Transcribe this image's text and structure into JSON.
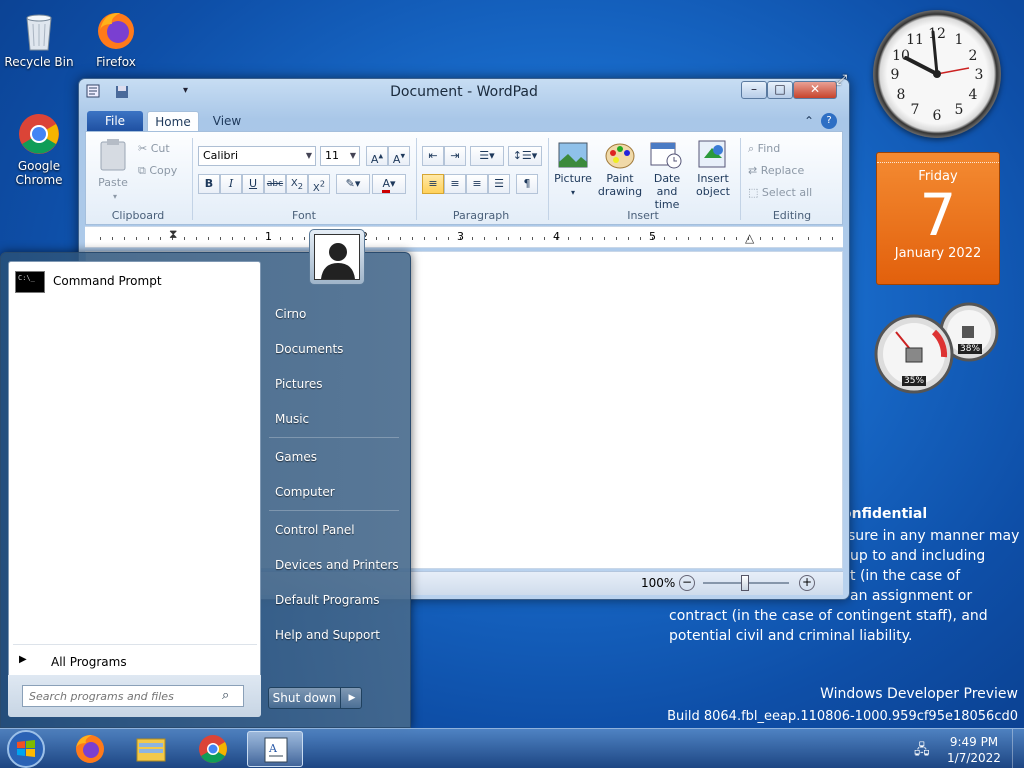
{
  "desktop": {
    "icons": [
      {
        "label": "Recycle Bin"
      },
      {
        "label": "Firefox"
      },
      {
        "label": "Google Chrome"
      }
    ],
    "watermark_title": "onfidential",
    "watermark_lines": [
      "sure in any manner may",
      "up to and including",
      "t (in the case of",
      "an assignment or",
      "contract (in the case of contingent staff), and",
      "potential civil and criminal liability."
    ],
    "build_line1": "Windows Developer Preview",
    "build_line2": "Build 8064.fbl_eeap.110806-1000.959cf95e18056cd0"
  },
  "wordpad": {
    "title": "Document - WordPad",
    "tabs": {
      "file": "File",
      "home": "Home",
      "view": "View"
    },
    "clipboard": {
      "paste": "Paste",
      "cut": "Cut",
      "copy": "Copy",
      "label": "Clipboard"
    },
    "font": {
      "family": "Calibri",
      "size": "11",
      "label": "Font"
    },
    "paragraph": {
      "label": "Paragraph"
    },
    "insert": {
      "picture": "Picture",
      "paint1": "Paint",
      "paint2": "drawing",
      "date1": "Date and",
      "date2": "time",
      "obj1": "Insert",
      "obj2": "object",
      "label": "Insert"
    },
    "editing": {
      "find": "Find",
      "replace": "Replace",
      "select_all": "Select all",
      "label": "Editing"
    },
    "ruler_numbers": [
      "1",
      "2",
      "3",
      "4",
      "5"
    ],
    "zoom": "100%"
  },
  "start_menu": {
    "program": "Command Prompt",
    "all_programs": "All Programs",
    "search_placeholder": "Search programs and files",
    "right_items": [
      "Cirno",
      "Documents",
      "Pictures",
      "Music",
      "Games",
      "Computer",
      "Control Panel",
      "Devices and Printers",
      "Default Programs",
      "Help and Support"
    ],
    "shutdown": "Shut down"
  },
  "gadgets": {
    "calendar": {
      "day": "Friday",
      "date": "7",
      "month": "January 2022"
    },
    "cpu": {
      "value": "35%",
      "value2": "38%"
    }
  },
  "taskbar": {
    "time": "9:49 PM",
    "date": "1/7/2022"
  },
  "colors": {
    "accent": "#1a6fcf",
    "calendar": "#e8701a"
  }
}
